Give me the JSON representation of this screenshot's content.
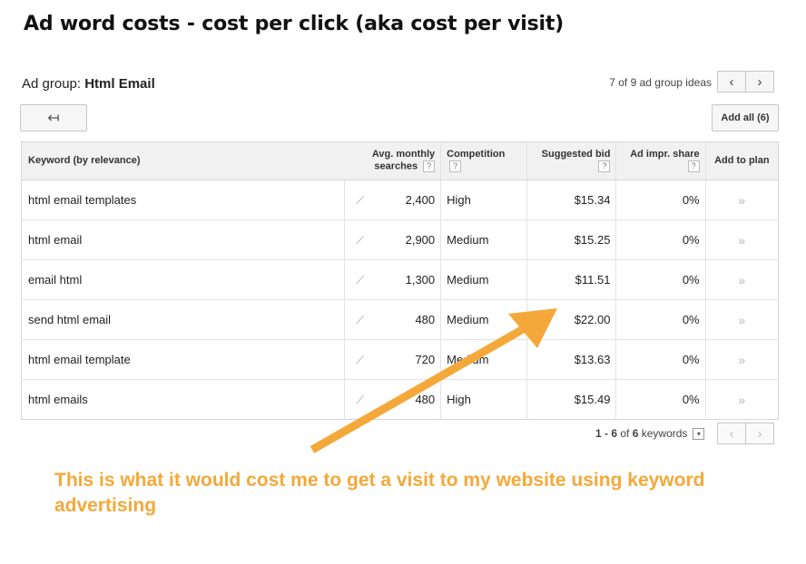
{
  "page_title": "Ad word costs - cost per click (aka cost per visit)",
  "ad_group": {
    "label": "Ad group:",
    "name": "Html Email"
  },
  "ideas_count": "7 of 9 ad group ideas",
  "pager": {
    "prev": "‹",
    "next": "›"
  },
  "back_button": "↤",
  "add_all_button": "Add all (6)",
  "table": {
    "headers": {
      "keyword": "Keyword (by relevance)",
      "searches_line1": "Avg. monthly",
      "searches_line2": "searches",
      "competition": "Competition",
      "bid": "Suggested bid",
      "impr_share": "Ad impr. share",
      "add_to_plan": "Add to plan",
      "help": "?"
    },
    "rows": [
      {
        "keyword": "html email templates",
        "searches": "2,400",
        "competition": "High",
        "bid": "$15.34",
        "impr": "0%"
      },
      {
        "keyword": "html email",
        "searches": "2,900",
        "competition": "Medium",
        "bid": "$15.25",
        "impr": "0%"
      },
      {
        "keyword": "email html",
        "searches": "1,300",
        "competition": "Medium",
        "bid": "$11.51",
        "impr": "0%"
      },
      {
        "keyword": "send html email",
        "searches": "480",
        "competition": "Medium",
        "bid": "$22.00",
        "impr": "0%"
      },
      {
        "keyword": "html email template",
        "searches": "720",
        "competition": "Medium",
        "bid": "$13.63",
        "impr": "0%"
      },
      {
        "keyword": "html emails",
        "searches": "480",
        "competition": "High",
        "bid": "$15.49",
        "impr": "0%"
      }
    ]
  },
  "footer": {
    "range": "1 - 6",
    "of": "of",
    "total": "6",
    "unit": "keywords",
    "dropdown": "▾"
  },
  "annotation": "This is what it would cost me to get a visit to my website using keyword advertising",
  "colors": {
    "annotation": "#f5a83a",
    "header_bg": "#f1f1f1"
  },
  "icons": {
    "trend": "chart-trend-icon",
    "add": "add-to-plan-icon"
  }
}
